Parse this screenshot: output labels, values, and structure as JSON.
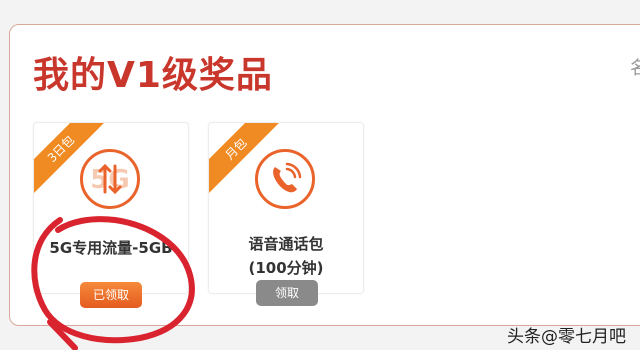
{
  "title": "我的V1级奖品",
  "edge_char": "名",
  "cards": [
    {
      "ribbon": "3日包",
      "icon": "5g-data-icon",
      "label": "5G专用流量-5GB",
      "button": "已领取",
      "button_color": "#e9632b"
    },
    {
      "ribbon": "月包",
      "icon": "phone-call-icon",
      "label_line1": "语音通话包",
      "label_line2": "(100分钟)",
      "button": "领取",
      "button_color": "#8a8a8a"
    }
  ],
  "watermark": "头条@零七月吧",
  "colors": {
    "accent": "#c9372c",
    "ribbon": "#f08a22",
    "annotation": "#d9232e"
  }
}
